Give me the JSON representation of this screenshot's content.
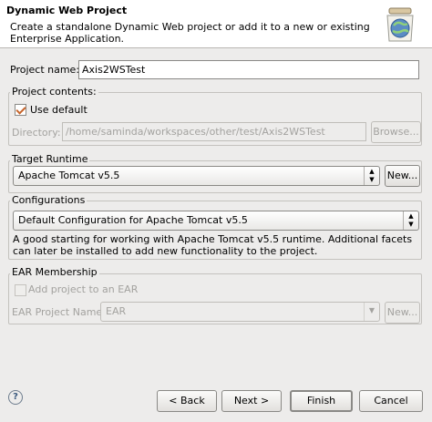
{
  "header": {
    "title": "Dynamic Web Project",
    "description": "Create a standalone Dynamic Web project or add it to a new or existing Enterprise Application."
  },
  "project_name": {
    "label": "Project name:",
    "value": "Axis2WSTest"
  },
  "project_contents": {
    "title": "Project contents:",
    "use_default_label": "Use default",
    "use_default_checked": true,
    "directory_label": "Directory:",
    "directory_value": "/home/saminda/workspaces/other/test/Axis2WSTest",
    "browse_label": "Browse..."
  },
  "target_runtime": {
    "title": "Target Runtime",
    "selected": "Apache Tomcat v5.5",
    "new_label": "New..."
  },
  "configurations": {
    "title": "Configurations",
    "selected": "Default Configuration for Apache Tomcat v5.5",
    "description": "A good starting for working with Apache Tomcat v5.5 runtime. Additional facets can later be installed to add new functionality to the project."
  },
  "ear_membership": {
    "title": "EAR Membership",
    "add_label": "Add project to an EAR",
    "add_checked": false,
    "ear_name_label": "EAR Project Name:",
    "ear_name_value": "EAR",
    "new_label": "New..."
  },
  "footer": {
    "back_label": "< Back",
    "next_label": "Next >",
    "finish_label": "Finish",
    "cancel_label": "Cancel"
  },
  "icons": {
    "help": "help-icon",
    "wizard": "web-project-wizard-icon"
  }
}
